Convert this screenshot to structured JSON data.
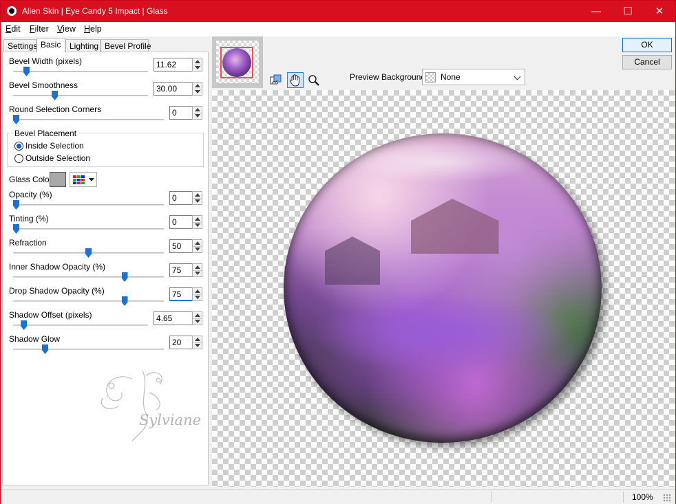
{
  "window": {
    "title": "Alien Skin | Eye Candy 5 Impact | Glass",
    "minimize": "—",
    "maximize": "☐",
    "close": "✕"
  },
  "menu": {
    "items": [
      {
        "first": "E",
        "rest": "dit"
      },
      {
        "first": "F",
        "rest": "ilter"
      },
      {
        "first": "V",
        "rest": "iew"
      },
      {
        "first": "H",
        "rest": "elp"
      }
    ]
  },
  "tabs": [
    "Settings",
    "Basic",
    "Lighting",
    "Bevel Profile"
  ],
  "active_tab": "Basic",
  "controls": {
    "bevel_width": {
      "label": "Bevel Width (pixels)",
      "value": "11.62",
      "slider": 0.08
    },
    "bevel_smoothness": {
      "label": "Bevel Smoothness",
      "value": "30.00",
      "slider": 0.3
    },
    "round_corners": {
      "label": "Round Selection Corners",
      "value": "0",
      "slider": 0.0
    },
    "bevel_placement": {
      "legend": "Bevel Placement",
      "inside": "Inside Selection",
      "outside": "Outside Selection",
      "selected": "inside"
    },
    "glass_color": {
      "label": "Glass Color",
      "swatch": "#a8a8a8"
    },
    "opacity": {
      "label": "Opacity (%)",
      "value": "0",
      "slider": 0.0
    },
    "tinting": {
      "label": "Tinting (%)",
      "value": "0",
      "slider": 0.0
    },
    "refraction": {
      "label": "Refraction",
      "value": "50",
      "slider": 0.5
    },
    "inner_shadow_opacity": {
      "label": "Inner Shadow Opacity (%)",
      "value": "75",
      "slider": 0.75
    },
    "drop_shadow_opacity": {
      "label": "Drop Shadow Opacity (%)",
      "value": "75",
      "slider": 0.75
    },
    "shadow_offset": {
      "label": "Shadow Offset (pixels)",
      "value": "4.65",
      "slider": 0.06
    },
    "shadow_glow": {
      "label": "Shadow Glow",
      "value": "20",
      "slider": 0.2
    }
  },
  "watermark": "Sylviane",
  "buttons": {
    "ok": "OK",
    "cancel": "Cancel"
  },
  "preview": {
    "background_label": "Preview Background:",
    "background_value": "None"
  },
  "status": {
    "zoom": "100%"
  },
  "colors": {
    "titlebar": "#d80f1e",
    "accent": "#1a73d2"
  }
}
